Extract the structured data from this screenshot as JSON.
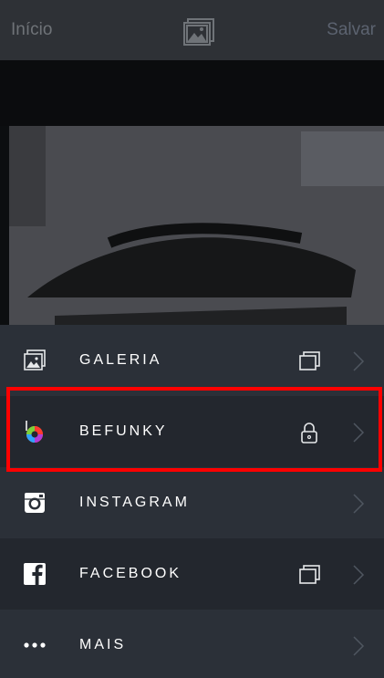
{
  "topbar": {
    "left_label": "Início",
    "right_label": "Salvar",
    "center_icon": "gallery-image-icon"
  },
  "menu": {
    "items": [
      {
        "label": "GALERIA",
        "icon": "gallery-icon",
        "trail_icon": "copy-icon"
      },
      {
        "label": "BEFUNKY",
        "icon": "befunky-logo-icon",
        "trail_icon": "lock-icon"
      },
      {
        "label": "INSTAGRAM",
        "icon": "instagram-icon",
        "trail_icon": ""
      },
      {
        "label": "FACEBOOK",
        "icon": "facebook-icon",
        "trail_icon": "copy-icon"
      },
      {
        "label": "MAIS",
        "icon": "more-dots-icon",
        "trail_icon": ""
      }
    ]
  },
  "colors": {
    "topbar_bg": "#2e3136",
    "menu_bg_1": "#2b3038",
    "menu_bg_2": "#23272e",
    "highlight": "#ff0000"
  }
}
